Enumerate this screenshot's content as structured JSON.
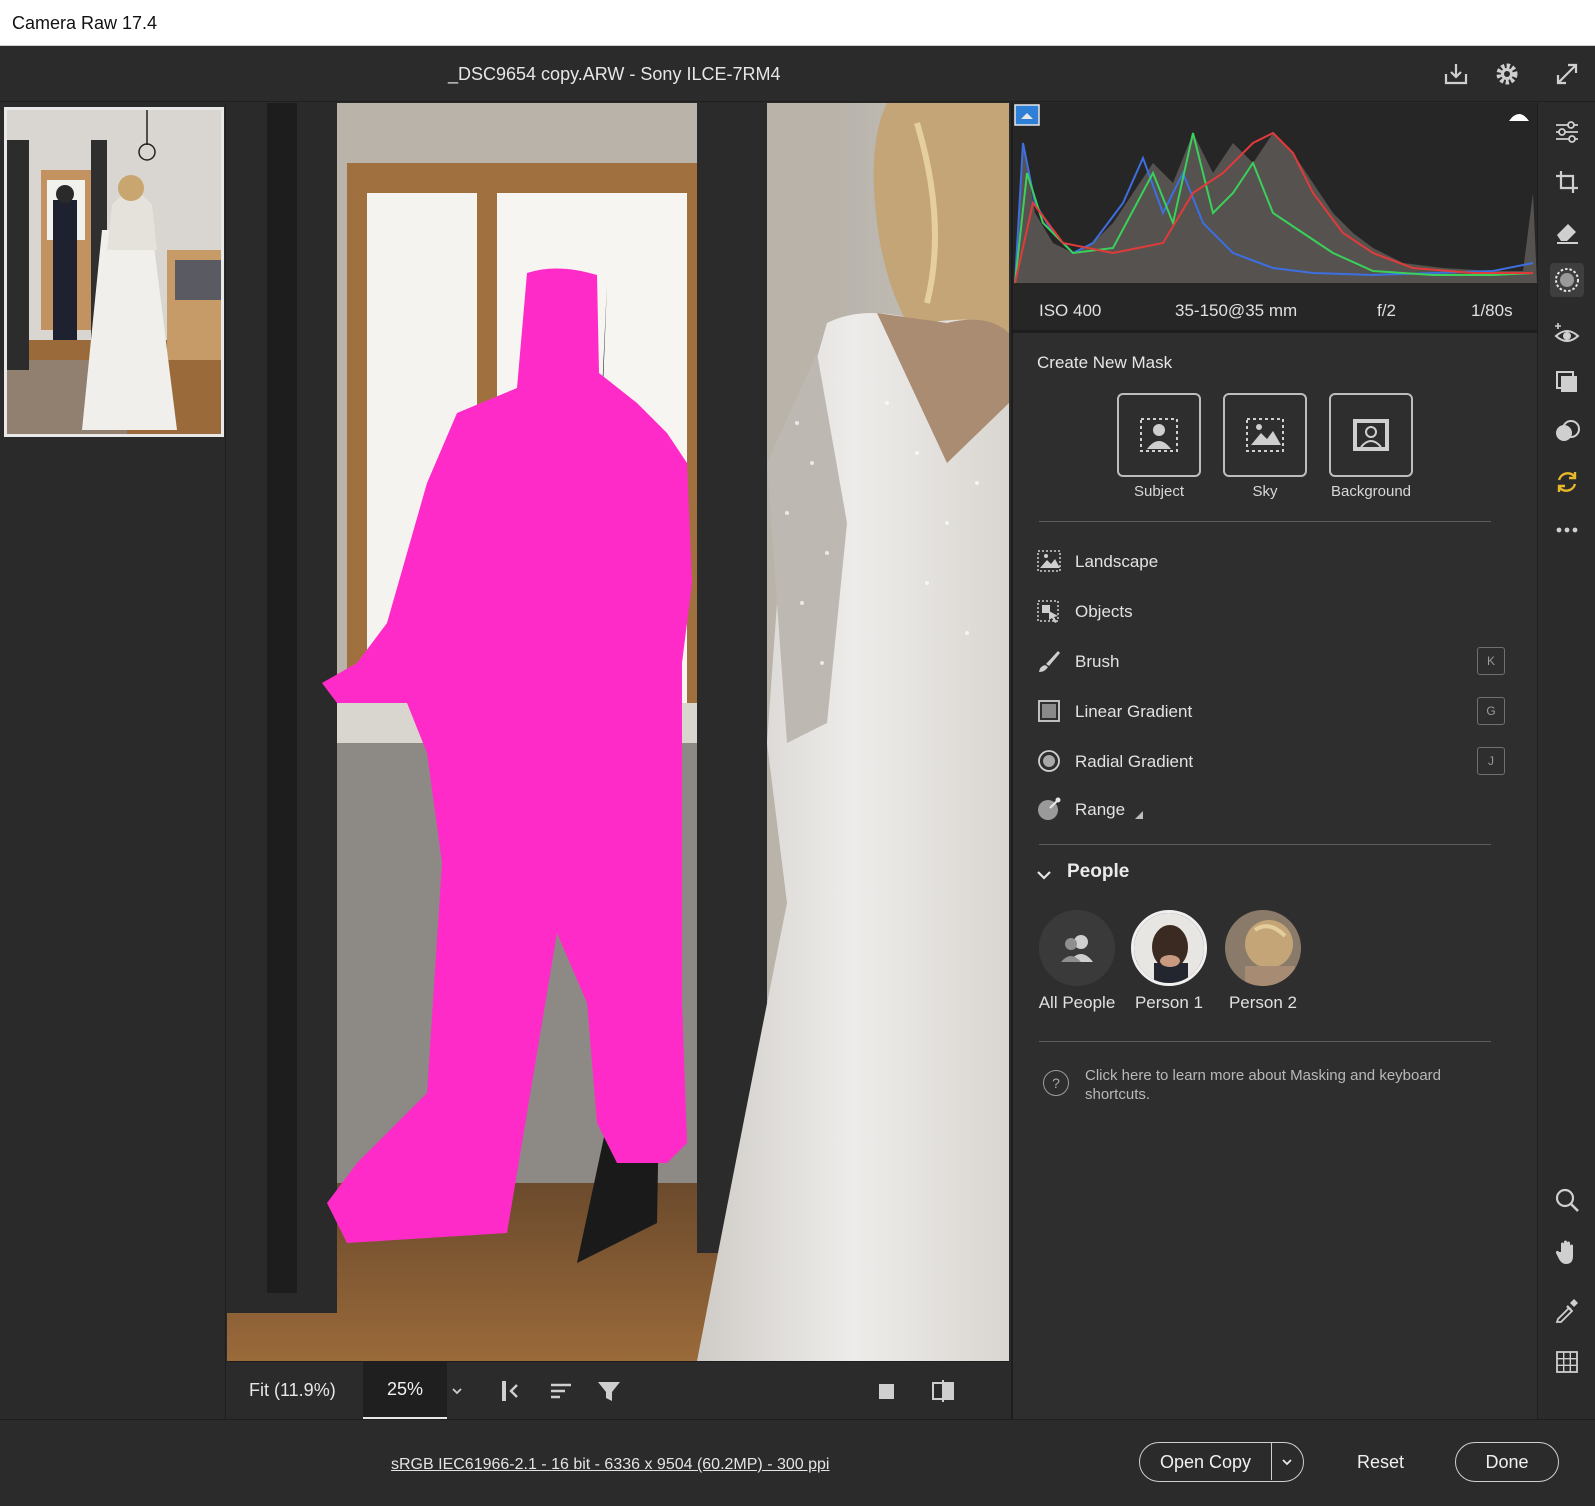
{
  "window": {
    "title": "Camera Raw 17.4"
  },
  "header": {
    "file_title": "_DSC9654 copy.ARW  -  Sony ILCE-7RM4",
    "icons": [
      "save-icon",
      "gear-icon",
      "fullscreen-icon"
    ]
  },
  "exif": {
    "iso": "ISO 400",
    "lens": "35-150@35 mm",
    "aperture": "f/2",
    "shutter": "1/80s"
  },
  "mask_panel": {
    "title": "Create New Mask",
    "quick_masks": [
      {
        "label": "Subject"
      },
      {
        "label": "Sky"
      },
      {
        "label": "Background"
      }
    ],
    "tools": [
      {
        "label": "Landscape",
        "key": ""
      },
      {
        "label": "Objects",
        "key": ""
      },
      {
        "label": "Brush",
        "key": "K"
      },
      {
        "label": "Linear Gradient",
        "key": "G"
      },
      {
        "label": "Radial Gradient",
        "key": "J"
      },
      {
        "label": "Range",
        "key": ""
      }
    ],
    "people": {
      "title": "People",
      "items": [
        {
          "label": "All People"
        },
        {
          "label": "Person 1"
        },
        {
          "label": "Person 2"
        }
      ]
    },
    "help_text": "Click here to learn more about Masking and keyboard shortcuts."
  },
  "bottombar": {
    "fit": "Fit (11.9%)",
    "zoom": "25%"
  },
  "footer": {
    "info": "sRGB IEC61966-2.1 - 16 bit - 6336 x 9504 (60.2MP) - 300 ppi",
    "open_copy": "Open Copy",
    "reset": "Reset",
    "done": "Done"
  },
  "colors": {
    "mask_overlay": "#ff2bc8",
    "panel_bg": "#2e2e2e",
    "accent_blue": "#2f7fd6"
  }
}
